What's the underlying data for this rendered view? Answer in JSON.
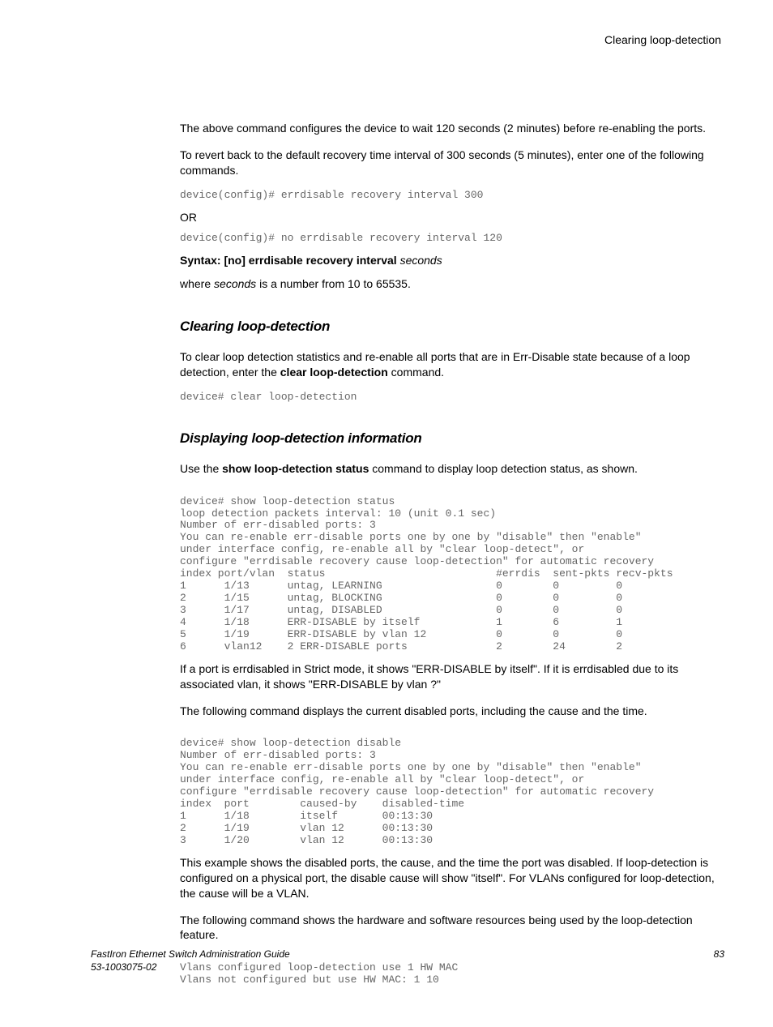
{
  "header": {
    "topic": "Clearing loop-detection"
  },
  "intro": {
    "p1": "The above command configures the device to wait 120 seconds (2 minutes) before re-enabling the ports.",
    "p2": "To revert back to the default recovery time interval of 300 seconds (5 minutes), enter one of the following commands."
  },
  "code1": "device(config)# errdisable recovery interval 300",
  "or_label": "OR",
  "code2": "device(config)# no errdisable recovery interval 120",
  "syntax": {
    "prefix": "Syntax: [no] errdisable recovery interval ",
    "arg": "seconds"
  },
  "where": {
    "prefix": "where ",
    "arg": "seconds",
    "suffix": " is a number from 10 to 65535."
  },
  "section_clearing": {
    "title": "Clearing loop-detection",
    "p1a": "To clear loop detection statistics and re-enable all ports that are in Err-Disable state because of a loop detection, enter the ",
    "p1_cmd": "clear loop-detection",
    "p1b": " command.",
    "code": "device# clear loop-detection"
  },
  "section_display": {
    "title": "Displaying loop-detection information",
    "p1a": "Use the ",
    "p1_cmd": "show loop-detection status",
    "p1b": " command to display loop detection status, as shown.",
    "code_status": "device# show loop-detection status\nloop detection packets interval: 10 (unit 0.1 sec)\nNumber of err-disabled ports: 3\nYou can re-enable err-disable ports one by one by \"disable\" then \"enable\"\nunder interface config, re-enable all by \"clear loop-detect\", or\nconfigure \"errdisable recovery cause loop-detection\" for automatic recovery\nindex port/vlan  status                           #errdis  sent-pkts recv-pkts\n1      1/13      untag, LEARNING                  0        0         0\n2      1/15      untag, BLOCKING                  0        0         0\n3      1/17      untag, DISABLED                  0        0         0\n4      1/18      ERR-DISABLE by itself            1        6         1\n5      1/19      ERR-DISABLE by vlan 12           0        0         0\n6      vlan12    2 ERR-DISABLE ports              2        24        2",
    "p2": "If a port is errdisabled in Strict mode, it shows \"ERR-DISABLE by itself\". If it is errdisabled due to its associated vlan, it shows \"ERR-DISABLE by vlan ?\"",
    "p3": "The following command displays the current disabled ports, including the cause and the time.",
    "code_disable": "device# show loop-detection disable\nNumber of err-disabled ports: 3\nYou can re-enable err-disable ports one by one by \"disable\" then \"enable\"\nunder interface config, re-enable all by \"clear loop-detect\", or\nconfigure \"errdisable recovery cause loop-detection\" for automatic recovery\nindex  port        caused-by    disabled-time\n1      1/18        itself       00:13:30\n2      1/19        vlan 12      00:13:30\n3      1/20        vlan 12      00:13:30",
    "p4": "This example shows the disabled ports, the cause, and the time the port was disabled. If loop-detection is configured on a physical port, the disable cause will show \"itself\". For VLANs configured for loop-detection, the cause will be a VLAN.",
    "p5": "The following command shows the hardware and software resources being used by the loop-detection feature.",
    "code_vlans": "Vlans configured loop-detection use 1 HW MAC\nVlans not configured but use HW MAC: 1 10"
  },
  "footer": {
    "title": "FastIron Ethernet Switch Administration Guide",
    "docnum": "53-1003075-02",
    "page": "83"
  }
}
